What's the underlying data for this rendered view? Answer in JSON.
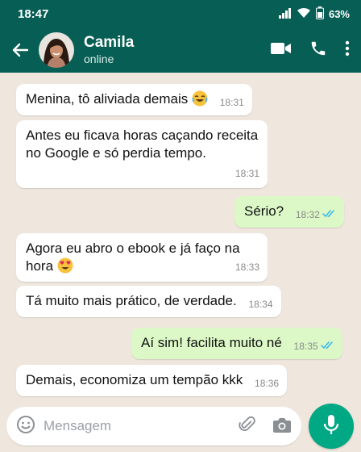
{
  "statusbar": {
    "time": "18:47",
    "battery": "63%"
  },
  "header": {
    "contact_name": "Camila",
    "contact_status": "online"
  },
  "messages": [
    {
      "direction": "in",
      "text": "Menina, tô aliviada demais",
      "emoji": "laughing-emoji",
      "time": "18:31"
    },
    {
      "direction": "in",
      "text": "Antes eu ficava horas caçando receita no Google e só perdia tempo.",
      "time": "18:31"
    },
    {
      "direction": "out",
      "text": "Sério?",
      "time": "18:32",
      "status": "read"
    },
    {
      "direction": "in",
      "text": "Agora eu abro o ebook e já faço na hora",
      "emoji": "heart-eyes-emoji",
      "time": "18:33"
    },
    {
      "direction": "in",
      "text": "Tá muito mais prático, de verdade.",
      "time": "18:34"
    },
    {
      "direction": "out",
      "text": "Aí sim! facilita muito né",
      "time": "18:35",
      "status": "read"
    },
    {
      "direction": "in",
      "text": "Demais, economiza um tempão kkk",
      "time": "18:36"
    }
  ],
  "composer": {
    "placeholder": "Mensagem"
  },
  "colors": {
    "header": "#075e54",
    "outgoing": "#dcf8c6",
    "incoming": "#ffffff",
    "accent": "#00a884",
    "read_ticks": "#34b7f1",
    "chat_bg": "#efe7de"
  }
}
